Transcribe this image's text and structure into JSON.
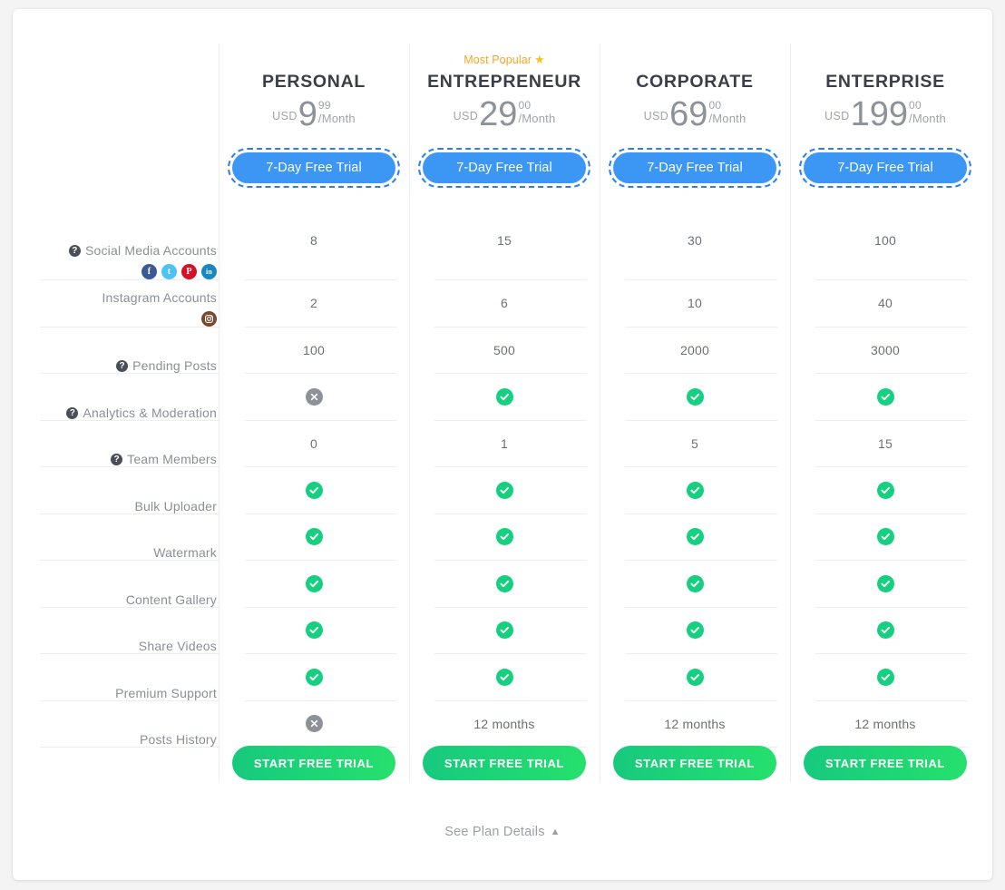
{
  "card": {
    "background": "#ffffff",
    "page_background": "#f4f4f4"
  },
  "colors": {
    "accent_blue": "#3b97f3",
    "cta_green_start": "#16c97e",
    "cta_green_end": "#26e06d",
    "tick_green": "#15d07e",
    "cross_gray": "#8d9199",
    "popular_orange": "#f5a623",
    "star_gold": "#f7c325",
    "text_gray": "#6b7079",
    "divider": "#eceef0"
  },
  "plans": [
    {
      "name": "PERSONAL",
      "currency": "USD",
      "amount": "9",
      "fraction": "99",
      "period": "/Month",
      "badge": null,
      "trial_label": "7-Day Free Trial",
      "cta_label": "START FREE TRIAL"
    },
    {
      "name": "ENTREPRENEUR",
      "currency": "USD",
      "amount": "29",
      "fraction": "00",
      "period": "/Month",
      "badge": "Most Popular",
      "badge_icon": "star-icon",
      "trial_label": "7-Day Free Trial",
      "cta_label": "START FREE TRIAL"
    },
    {
      "name": "CORPORATE",
      "currency": "USD",
      "amount": "69",
      "fraction": "00",
      "period": "/Month",
      "badge": null,
      "trial_label": "7-Day Free Trial",
      "cta_label": "START FREE TRIAL"
    },
    {
      "name": "ENTERPRISE",
      "currency": "USD",
      "amount": "199",
      "fraction": "00",
      "period": "/Month",
      "badge": null,
      "trial_label": "7-Day Free Trial",
      "cta_label": "START FREE TRIAL"
    }
  ],
  "features": [
    {
      "label": "Social Media Accounts",
      "has_help": true,
      "social_icons": [
        "facebook-icon",
        "twitter-icon",
        "pinterest-icon",
        "linkedin-icon"
      ],
      "values": [
        "8",
        "15",
        "30",
        "100"
      ],
      "types": [
        "text",
        "text",
        "text",
        "text"
      ]
    },
    {
      "label": "Instagram Accounts",
      "has_help": false,
      "social_icons": [
        "instagram-icon"
      ],
      "values": [
        "2",
        "6",
        "10",
        "40"
      ],
      "types": [
        "text",
        "text",
        "text",
        "text"
      ]
    },
    {
      "label": "Pending Posts",
      "has_help": true,
      "social_icons": [],
      "values": [
        "100",
        "500",
        "2000",
        "3000"
      ],
      "types": [
        "text",
        "text",
        "text",
        "text"
      ]
    },
    {
      "label": "Analytics & Moderation",
      "has_help": true,
      "social_icons": [],
      "values": [
        "",
        "",
        "",
        ""
      ],
      "types": [
        "cross",
        "tick",
        "tick",
        "tick"
      ]
    },
    {
      "label": "Team Members",
      "has_help": true,
      "social_icons": [],
      "values": [
        "0",
        "1",
        "5",
        "15"
      ],
      "types": [
        "text",
        "text",
        "text",
        "text"
      ]
    },
    {
      "label": "Bulk Uploader",
      "has_help": false,
      "social_icons": [],
      "values": [
        "",
        "",
        "",
        ""
      ],
      "types": [
        "tick",
        "tick",
        "tick",
        "tick"
      ]
    },
    {
      "label": "Watermark",
      "has_help": false,
      "social_icons": [],
      "values": [
        "",
        "",
        "",
        ""
      ],
      "types": [
        "tick",
        "tick",
        "tick",
        "tick"
      ]
    },
    {
      "label": "Content Gallery",
      "has_help": false,
      "social_icons": [],
      "values": [
        "",
        "",
        "",
        ""
      ],
      "types": [
        "tick",
        "tick",
        "tick",
        "tick"
      ]
    },
    {
      "label": "Share Videos",
      "has_help": false,
      "social_icons": [],
      "values": [
        "",
        "",
        "",
        ""
      ],
      "types": [
        "tick",
        "tick",
        "tick",
        "tick"
      ]
    },
    {
      "label": "Premium Support",
      "has_help": false,
      "social_icons": [],
      "values": [
        "",
        "",
        "",
        ""
      ],
      "types": [
        "tick",
        "tick",
        "tick",
        "tick"
      ]
    },
    {
      "label": "Posts History",
      "has_help": false,
      "social_icons": [],
      "values": [
        "",
        "12 months",
        "12 months",
        "12 months"
      ],
      "types": [
        "cross",
        "text",
        "text",
        "text"
      ]
    }
  ],
  "footer": {
    "see_details_label": "See Plan Details",
    "chevron": "chevron-up-icon"
  }
}
